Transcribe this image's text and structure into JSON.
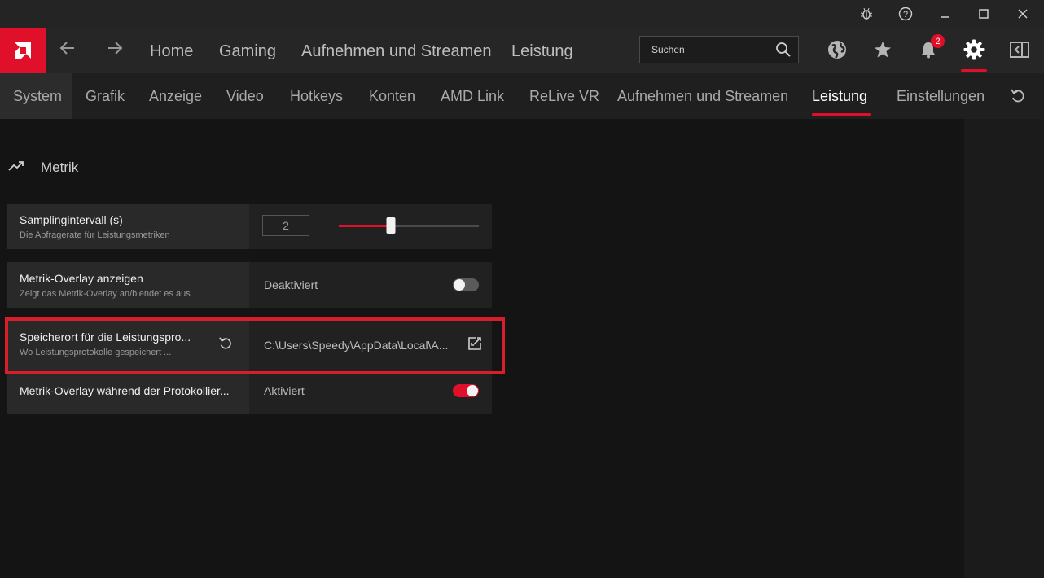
{
  "titlebar": {
    "icons": [
      "bug-icon",
      "help-icon",
      "minimize-icon",
      "maximize-icon",
      "close-icon"
    ]
  },
  "nav": {
    "links": [
      "Home",
      "Gaming",
      "Aufnehmen und Streamen",
      "Leistung"
    ],
    "search_placeholder": "Suchen",
    "notification_count": "2",
    "accent_color": "#e0102a"
  },
  "subnav": {
    "tabs": [
      "System",
      "Grafik",
      "Anzeige",
      "Video",
      "Hotkeys",
      "Konten",
      "AMD Link",
      "ReLive VR",
      "Aufnehmen und Streamen",
      "Leistung",
      "Einstellungen"
    ],
    "active": "Leistung"
  },
  "section": {
    "label": "Metrik"
  },
  "settings": {
    "sampling": {
      "title": "Samplingintervall (s)",
      "subtitle": "Die Abfragerate für Leistungsmetriken",
      "value": "2",
      "slider_fraction": 0.37
    },
    "overlay": {
      "title": "Metrik-Overlay anzeigen",
      "subtitle": "Zeigt das Metrik-Overlay an/blendet es aus",
      "status": "Deaktiviert",
      "enabled": false
    },
    "log_location": {
      "title": "Speicherort für die Leistungspro...",
      "subtitle": "Wo Leistungsprotokolle gespeichert ...",
      "path": "C:\\Users\\Speedy\\AppData\\Local\\A..."
    },
    "overlay_logging": {
      "title": "Metrik-Overlay während der Protokollier...",
      "status": "Aktiviert",
      "enabled": true
    }
  }
}
